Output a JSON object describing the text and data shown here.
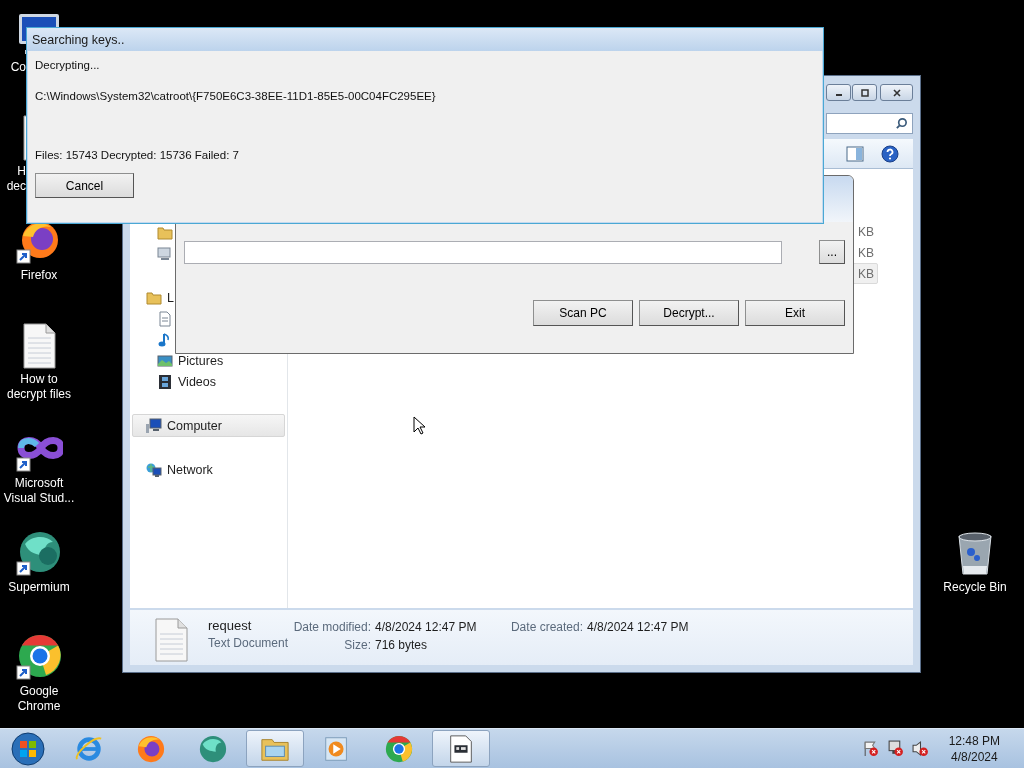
{
  "desktop_icons": [
    {
      "kind": "computer",
      "label": "Co",
      "cut": true
    },
    {
      "kind": "document",
      "label": "H dec",
      "cut": true
    },
    {
      "kind": "firefox",
      "label": "Firefox",
      "cut": false
    },
    {
      "kind": "document",
      "label": "How to decrypt files",
      "cut": false
    },
    {
      "kind": "infinity",
      "label": "Microsoft Visual Stud...",
      "cut": false
    },
    {
      "kind": "supermium",
      "label": "Supermium",
      "cut": false
    },
    {
      "kind": "chrome",
      "label": "Google Chrome",
      "cut": false
    }
  ],
  "recycle_bin": {
    "label": "Recycle Bin"
  },
  "explorer": {
    "navigation": [
      {
        "selected": false,
        "children": [
          {
            "kind": "downloads"
          },
          {
            "kind": "recent"
          }
        ]
      },
      {
        "kind": "library",
        "label": "L",
        "selected": false,
        "children": [
          {
            "kind": "documents"
          },
          {
            "kind": "music"
          },
          {
            "kind": "pictures",
            "label": "Pictures"
          },
          {
            "kind": "videos",
            "label": "Videos"
          }
        ]
      },
      {
        "kind": "computer",
        "label": "Computer",
        "selected": true
      },
      {
        "kind": "network",
        "label": "Network",
        "selected": false
      }
    ],
    "files": [
      {
        "size": "KB",
        "selected": false
      },
      {
        "size": "KB",
        "selected": false
      },
      {
        "size": "KB",
        "selected": true
      }
    ],
    "details": {
      "name": "request",
      "type": "Text Document",
      "properties": [
        {
          "label": "Date modified:",
          "value": "4/8/2024 12:47 PM"
        },
        {
          "label": "Size:",
          "value": "716 bytes"
        },
        {
          "label": "Date created:",
          "value": "4/8/2024 12:47 PM"
        }
      ]
    }
  },
  "decryptor": {
    "browse_button": "...",
    "buttons": [
      "Scan PC",
      "Decrypt...",
      "Exit"
    ]
  },
  "progress_dialog": {
    "title": "Searching keys..",
    "status": "Decrypting...",
    "current_file": "C:\\Windows\\System32\\catroot\\{F750E6C3-38EE-11D1-85E5-00C04FC295EE}",
    "summary": "Files: 15743 Decrypted: 15736 Failed: 7",
    "button": "Cancel"
  },
  "taskbar": {
    "items": [
      {
        "kind": "ie",
        "active": false
      },
      {
        "kind": "firefox",
        "active": false
      },
      {
        "kind": "supermium",
        "active": false
      },
      {
        "kind": "explorer",
        "active": true
      },
      {
        "kind": "media",
        "active": false
      },
      {
        "kind": "chrome",
        "active": false
      },
      {
        "kind": "app",
        "active": true
      }
    ],
    "clock": {
      "time": "12:48 PM",
      "date": "4/8/2024"
    }
  }
}
